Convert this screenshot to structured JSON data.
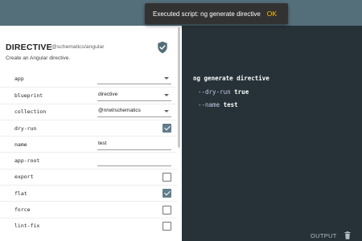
{
  "toast": {
    "message": "Executed script: ng generate directive",
    "action": "OK"
  },
  "panel": {
    "title": "DIRECTIVE",
    "package": "@schematics/angular",
    "description": "Create an Angular directive.",
    "shield_icon": "shield-check-icon"
  },
  "fields": [
    {
      "label": "app",
      "type": "select",
      "value": ""
    },
    {
      "label": "blueprint",
      "type": "select",
      "value": "directive"
    },
    {
      "label": "collection",
      "type": "select",
      "value": "@nrwl/schematics"
    },
    {
      "label": "dry-run",
      "type": "checkbox",
      "checked": true
    },
    {
      "label": "name",
      "type": "input",
      "value": "test"
    },
    {
      "label": "app-root",
      "type": "input",
      "value": ""
    },
    {
      "label": "export",
      "type": "checkbox",
      "checked": false
    },
    {
      "label": "flat",
      "type": "checkbox",
      "checked": true
    },
    {
      "label": "force",
      "type": "checkbox",
      "checked": false
    },
    {
      "label": "lint-fix",
      "type": "checkbox",
      "checked": false
    }
  ],
  "terminal": {
    "command": "ng generate directive",
    "options": [
      {
        "flag": "--dry-run",
        "value": "true"
      },
      {
        "flag": "--name",
        "value": "test"
      }
    ]
  },
  "footer": {
    "output_label": "OUTPUT",
    "trash_icon": "trash-icon"
  },
  "colors": {
    "toolbar": "#546e7a",
    "accent": "#ffc107",
    "checkbox": "#607d8b",
    "terminal_bg": "#263238"
  }
}
